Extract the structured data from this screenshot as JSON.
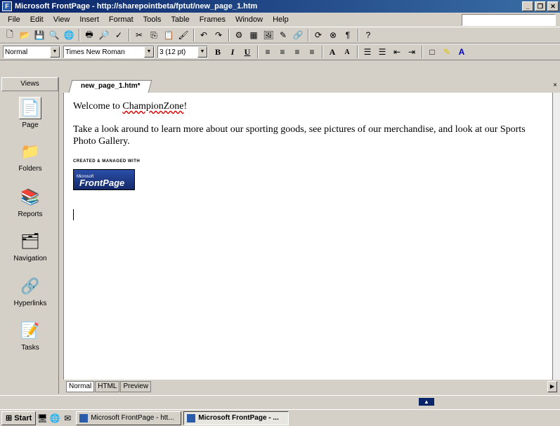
{
  "window": {
    "title": "Microsoft FrontPage - http://sharepointbeta/fptut/new_page_1.htm"
  },
  "menu": [
    "File",
    "Edit",
    "View",
    "Insert",
    "Format",
    "Tools",
    "Table",
    "Frames",
    "Window",
    "Help"
  ],
  "format_toolbar": {
    "style": "Normal",
    "font": "Times New Roman",
    "size": "3 (12 pt)"
  },
  "views": {
    "header": "Views",
    "items": [
      "Page",
      "Folders",
      "Reports",
      "Navigation",
      "Hyperlinks",
      "Tasks"
    ]
  },
  "document": {
    "tab": "new_page_1.htm*",
    "welcome_prefix": "Welcome to ",
    "welcome_name": "ChampionZone",
    "welcome_suffix": "!",
    "paragraph": "Take a look around to learn more about our sporting goods, see pictures of our merchandise, and look at our Sports Photo Gallery.",
    "badge_top": "CREATED & MANAGED WITH",
    "badge_ms": "Microsoft",
    "badge_text": "FrontPage"
  },
  "view_tabs": [
    "Normal",
    "HTML",
    "Preview"
  ],
  "taskbar": {
    "start": "Start",
    "tasks": [
      "Microsoft FrontPage - htt...",
      "Microsoft FrontPage - ..."
    ]
  }
}
